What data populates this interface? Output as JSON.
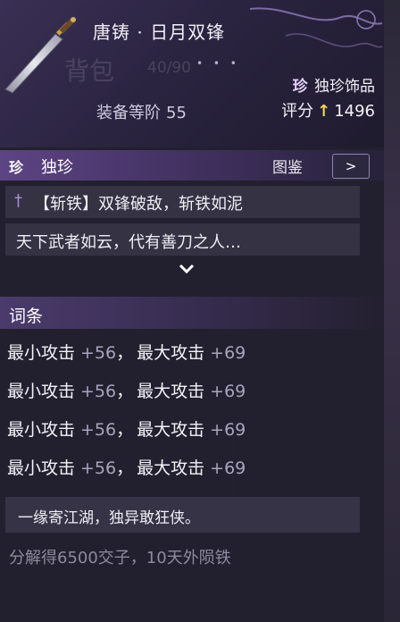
{
  "header": {
    "item_name": "唐铸 · 日月双锋",
    "bg_title": "背包",
    "bg_count": "40/90",
    "dots": "• • •",
    "rarity_mark": "珍",
    "rarity_label": "独珍饰品",
    "grade_label": "装备等阶",
    "grade_value": "55",
    "score_label": "评分",
    "score_arrow": "↑",
    "score_value": "1496"
  },
  "rarity_bar": {
    "mark": "珍",
    "title": "独珍",
    "atlas_label": "图鉴",
    "atlas_button": ">"
  },
  "skill": {
    "icon": "dagger-icon",
    "text": "【斩铁】双锋破敌，斩铁如泥"
  },
  "lore": "天下武者如云，代有善刀之人…",
  "expand_icon": "chevron-down-icon",
  "affix": {
    "title": "词条",
    "lines": [
      {
        "min_label": "最小攻击",
        "min_val": "+56",
        "sep": "，",
        "max_label": "最大攻击",
        "max_val": "+69"
      },
      {
        "min_label": "最小攻击",
        "min_val": "+56",
        "sep": "，",
        "max_label": "最大攻击",
        "max_val": "+69"
      },
      {
        "min_label": "最小攻击",
        "min_val": "+56",
        "sep": "，",
        "max_label": "最大攻击",
        "max_val": "+69"
      },
      {
        "min_label": "最小攻击",
        "min_val": "+56",
        "sep": "，",
        "max_label": "最大攻击",
        "max_val": "+69"
      }
    ]
  },
  "motto": "一缘寄江湖，独异敢狂侠。",
  "decompose": "分解得6500交子，10天外陨铁",
  "colors": {
    "accent": "#5d4484",
    "score_arrow": "#f2d35c",
    "value_grey": "#a9a4be"
  }
}
